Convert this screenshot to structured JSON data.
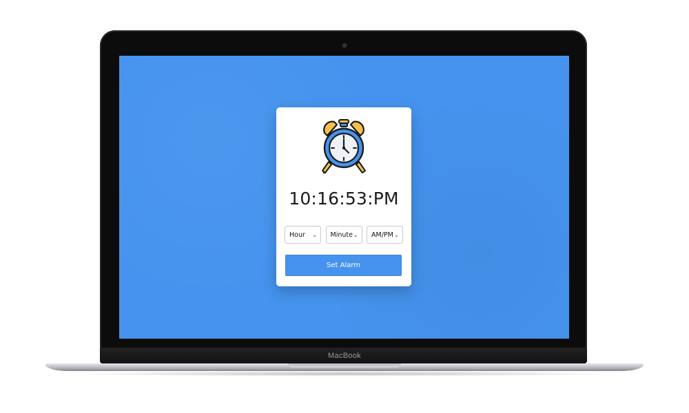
{
  "device": {
    "brand_label": "MacBook"
  },
  "alarm": {
    "time": "10:16:53:PM",
    "selects": [
      {
        "label": "Hour"
      },
      {
        "label": "Minute"
      },
      {
        "label": "AM/PM"
      }
    ],
    "button_label": "Set Alarm"
  },
  "colors": {
    "accent": "#4593ee",
    "clock_ring": "#4593ee",
    "bells": "#f6c14b"
  },
  "icons": {
    "clock": "alarm-clock-icon",
    "chevron": "chevron-down-icon"
  }
}
